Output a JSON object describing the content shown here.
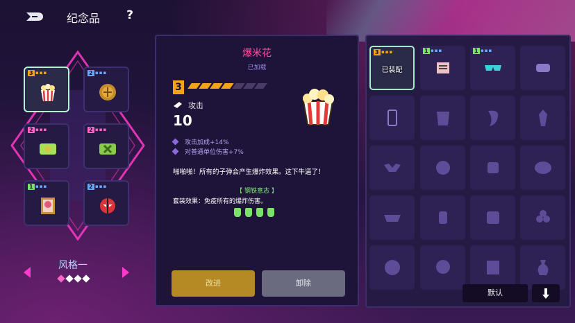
{
  "header": {
    "title": "纪念品",
    "help_label": "?"
  },
  "left_panel": {
    "style_name": "风格一",
    "style_page": {
      "current": 1,
      "total": 4
    },
    "slots": [
      {
        "level": "3",
        "rarity": "gold",
        "name": "popcorn",
        "selected": true
      },
      {
        "level": "2",
        "rarity": "blue",
        "name": "coin"
      },
      {
        "level": "2",
        "rarity": "pink",
        "name": "plus-card"
      },
      {
        "level": "2",
        "rarity": "pink",
        "name": "cross-card"
      },
      {
        "level": "1",
        "rarity": "green",
        "name": "portrait"
      },
      {
        "level": "2",
        "rarity": "blue",
        "name": "mask"
      }
    ]
  },
  "detail": {
    "name": "爆米花",
    "status": "已加载",
    "level": "3",
    "stars_filled": 4,
    "stars_total": 7,
    "attack_label": "攻击",
    "attack_value": "10",
    "bonuses": [
      "攻击加成+14%",
      "对普通单位伤害+7%"
    ],
    "description": "啪啪啪！所有的子弹会产生爆炸效果。这下牛逼了！",
    "set_name": "【 钢铁意志 】",
    "set_effect": "套装效果：免疫所有的爆炸伤害。",
    "set_pieces": 4,
    "upgrade_label": "改进",
    "remove_label": "卸除"
  },
  "grid": {
    "equipped_label": "已装配",
    "items": [
      {
        "level": "3",
        "rarity": "gold",
        "name": "popcorn",
        "selected": true
      },
      {
        "level": "1",
        "rarity": "blue",
        "name": "notepad"
      },
      {
        "level": "1",
        "rarity": "green",
        "name": "sunglasses"
      },
      {
        "level": "",
        "name": "game-controller"
      },
      {
        "name": "phone"
      },
      {
        "name": "armor"
      },
      {
        "name": "tooth"
      },
      {
        "name": "crystal"
      },
      {
        "name": "winged-badge"
      },
      {
        "name": "helmet"
      },
      {
        "name": "robot"
      },
      {
        "name": "speech-skull"
      },
      {
        "name": "mask"
      },
      {
        "name": "hand"
      },
      {
        "name": "jar"
      },
      {
        "name": "orb-cluster"
      },
      {
        "name": "lion"
      },
      {
        "name": "skull"
      },
      {
        "name": "frame"
      },
      {
        "name": "vase"
      }
    ],
    "default_label": "默认"
  },
  "colors": {
    "gold": "#f3a41a",
    "blue": "#6aa9ff",
    "pink": "#ff67c9",
    "green": "#7be26a",
    "neon_pink": "#ff39c8",
    "title_pink": "#ff4fa0"
  }
}
